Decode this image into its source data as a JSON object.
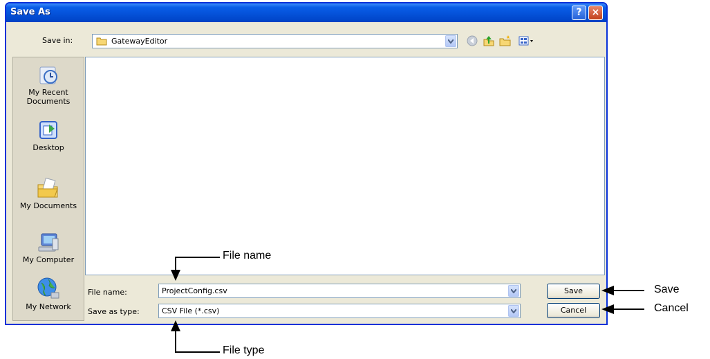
{
  "dialog": {
    "title": "Save As",
    "help_label": "?",
    "close_label": "×"
  },
  "save_in": {
    "label": "Save in:",
    "value": "GatewayEditor"
  },
  "toolbar": {
    "icons": [
      "back-icon",
      "up-folder-icon",
      "new-folder-icon",
      "views-menu-icon"
    ]
  },
  "places": [
    {
      "label": "My Recent Documents",
      "icon": "recent-documents-icon"
    },
    {
      "label": "Desktop",
      "icon": "desktop-icon"
    },
    {
      "label": "My Documents",
      "icon": "my-documents-icon"
    },
    {
      "label": "My Computer",
      "icon": "my-computer-icon"
    },
    {
      "label": "My Network",
      "icon": "my-network-icon"
    }
  ],
  "file_name": {
    "label": "File name:",
    "value": "ProjectConfig.csv"
  },
  "save_as_type": {
    "label": "Save as type:",
    "value": "CSV File (*.csv)"
  },
  "buttons": {
    "save": "Save",
    "cancel": "Cancel"
  },
  "callouts": {
    "file_name": "File name",
    "file_type": "File type",
    "save": "Save",
    "cancel": "Cancel"
  }
}
